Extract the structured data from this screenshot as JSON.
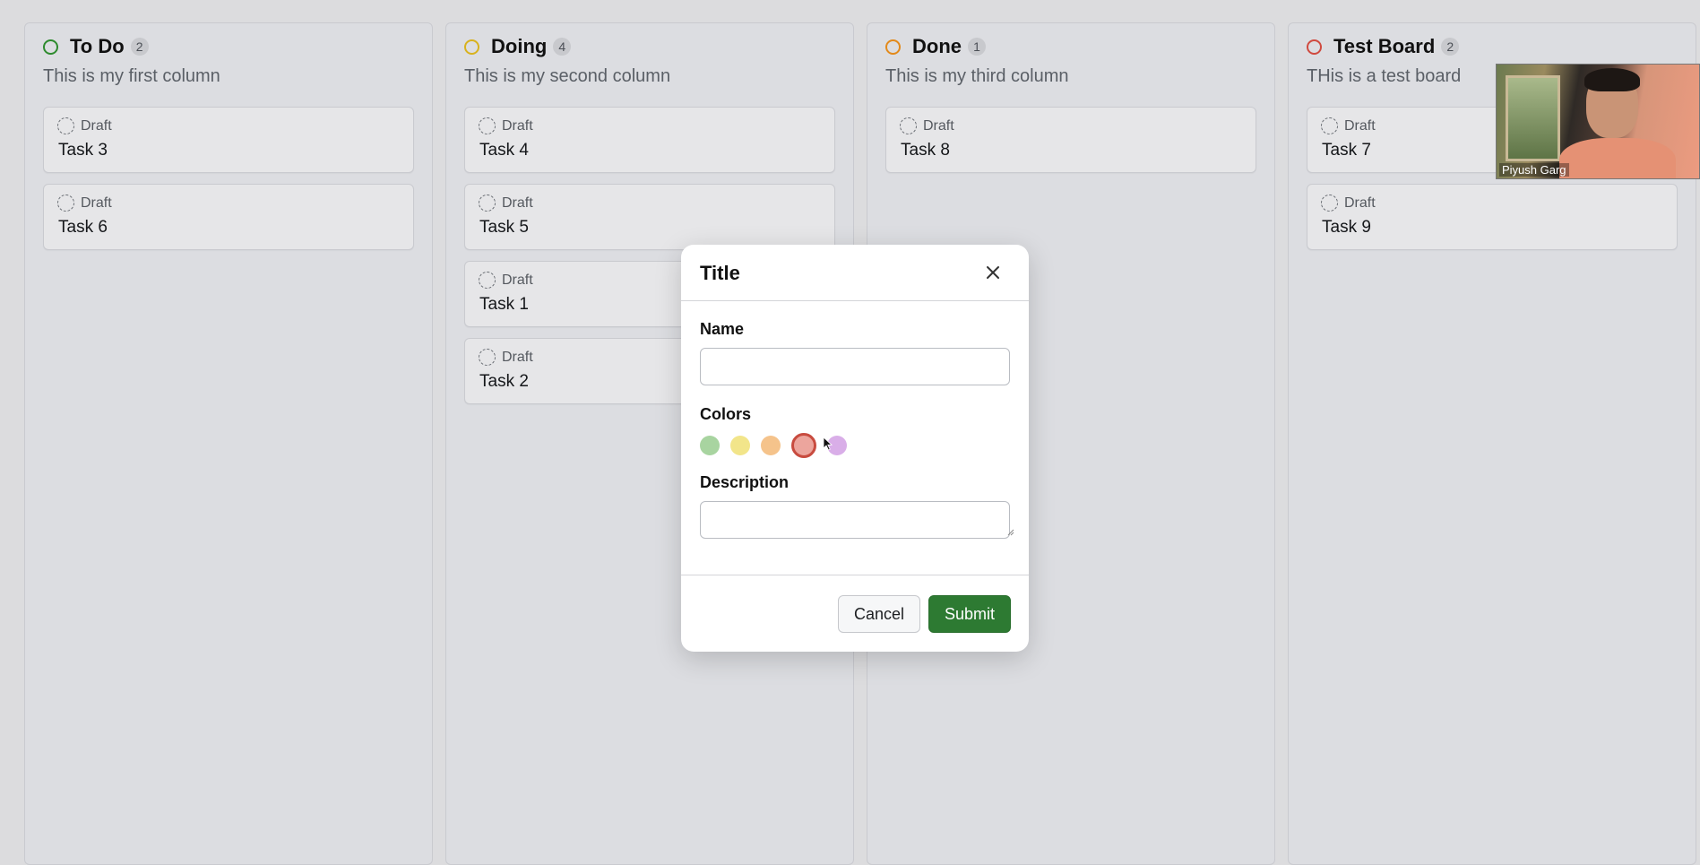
{
  "columns": [
    {
      "title": "To Do",
      "count": "2",
      "description": "This is my first column",
      "color": "#2e8b2e",
      "cards": [
        {
          "status": "Draft",
          "title": "Task 3"
        },
        {
          "status": "Draft",
          "title": "Task 6"
        }
      ]
    },
    {
      "title": "Doing",
      "count": "4",
      "description": "This is my second column",
      "color": "#d8b21e",
      "cards": [
        {
          "status": "Draft",
          "title": "Task 4"
        },
        {
          "status": "Draft",
          "title": "Task 5"
        },
        {
          "status": "Draft",
          "title": "Task 1"
        },
        {
          "status": "Draft",
          "title": "Task 2"
        }
      ]
    },
    {
      "title": "Done",
      "count": "1",
      "description": "This is my third column",
      "color": "#e38a1b",
      "cards": [
        {
          "status": "Draft",
          "title": "Task 8"
        }
      ]
    },
    {
      "title": "Test Board",
      "count": "2",
      "description": "THis is a test board",
      "color": "#d04a3f",
      "cards": [
        {
          "status": "Draft",
          "title": "Task 7"
        },
        {
          "status": "Draft",
          "title": "Task 9"
        }
      ]
    }
  ],
  "modal": {
    "title": "Title",
    "name_label": "Name",
    "name_value": "",
    "colors_label": "Colors",
    "colors": [
      "#a8d4a0",
      "#f2e58a",
      "#f5c38b",
      "#eca59d",
      "#d9aee8"
    ],
    "selected_color_index": 3,
    "description_label": "Description",
    "description_value": "",
    "cancel_label": "Cancel",
    "submit_label": "Submit"
  },
  "video": {
    "participant_name": "Piyush Garg"
  }
}
